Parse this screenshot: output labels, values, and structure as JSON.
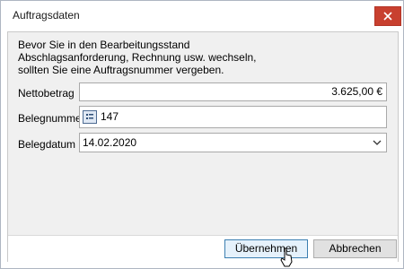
{
  "window": {
    "title": "Auftragsdaten"
  },
  "dialog": {
    "intro_text": "Bevor Sie in den Bearbeitungsstand\nAbschlagsanforderung, Rechnung usw. wechseln,\nsollten Sie eine Auftragsnummer vergeben.",
    "nettobetrag": {
      "label": "Nettobetrag",
      "value": "3.625,00 €"
    },
    "belegnummer": {
      "label": "Belegnummer",
      "value": "147",
      "icon": "number-picker-icon"
    },
    "belegdatum": {
      "label": "Belegdatum",
      "value": "14.02.2020",
      "icon": "chevron-down-icon"
    }
  },
  "buttons": {
    "ok": "Übernehmen",
    "cancel": "Abbrechen"
  },
  "colors": {
    "close_button": "#c8402f",
    "primary_border": "#3c7fb1"
  }
}
